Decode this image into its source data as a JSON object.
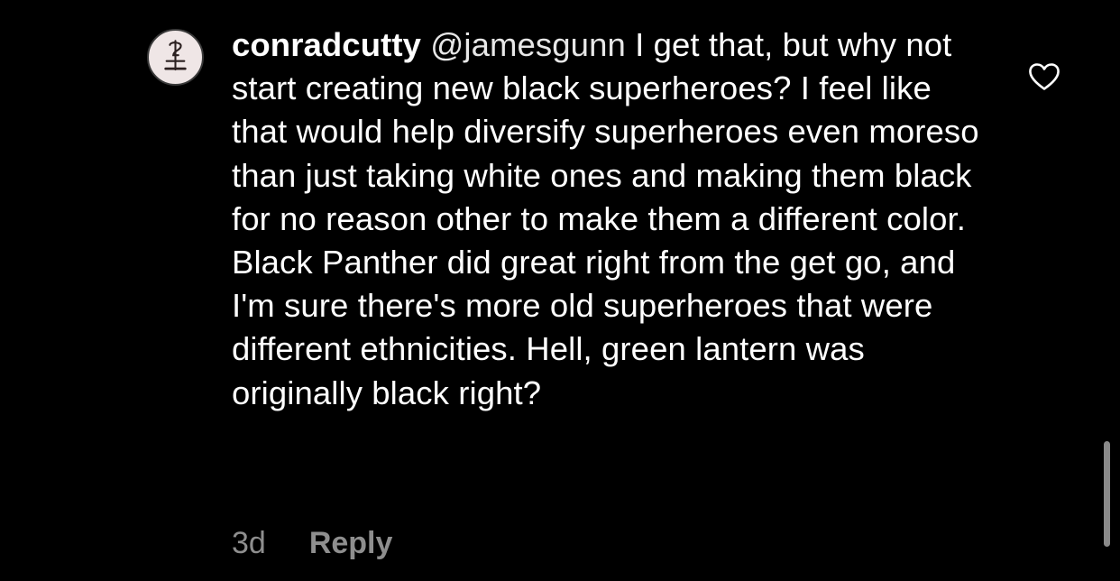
{
  "comment": {
    "username": "conradcutty",
    "mention": "@jamesgunn",
    "text": " I get that, but why not start creating new black superheroes? I feel like that would help diversify superheroes even moreso than just taking white ones and making them black for no reason other to make them a different color. Black Panther did great right from the get go, and I'm sure there's more old superheroes that were different ethnicities. Hell, green lantern was originally black right?",
    "timestamp": "3d",
    "reply_label": "Reply",
    "avatar_icon": "logo-avatar",
    "like_icon": "heart-outline-icon"
  },
  "colors": {
    "background": "#000000",
    "text": "#ffffff",
    "secondary": "#8e8e8e"
  }
}
